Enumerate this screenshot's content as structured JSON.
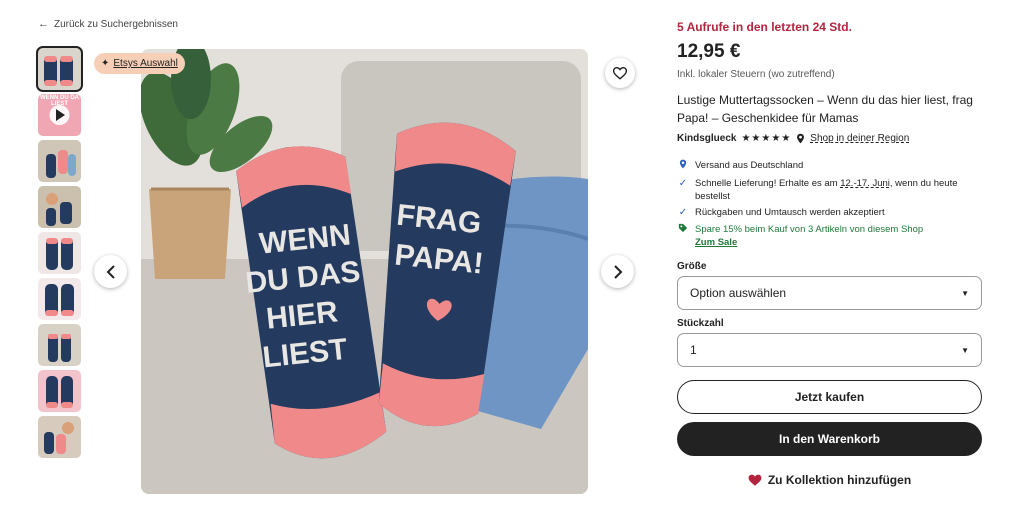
{
  "nav": {
    "back_label": "Zurück zu Suchergebnissen"
  },
  "gallery": {
    "badge_label": "Etsys Auswahl",
    "thumbnail_count": 9,
    "video_thumb_text": "WENN DU DA LIEST"
  },
  "product_image": {
    "left_sock_text": [
      "WENN",
      "DU DAS",
      "HIER",
      "LIEST"
    ],
    "right_sock_text": [
      "FRAG",
      "PAPA!"
    ]
  },
  "listing": {
    "views_text": "5 Aufrufe in den letzten 24 Std.",
    "price": "12,95 €",
    "tax_note": "Inkl. lokaler Steuern (wo zutreffend)",
    "title": "Lustige Muttertagssocken – Wenn du das hier liest, frag Papa! – Geschenkidee für Mamas",
    "shop_name": "Kindsglueck",
    "rating_stars": "★★★★★",
    "rating": 5,
    "shop_region_link": "Shop in deiner Region"
  },
  "features": {
    "shipping_from": "Versand aus Deutschland",
    "fast_delivery_prefix": "Schnelle Lieferung! Erhalte es am ",
    "fast_delivery_dates": "12.-17. Juni",
    "fast_delivery_suffix": ", wenn du heute bestellst",
    "returns": "Rückgaben und Umtausch werden akzeptiert",
    "discount": "Spare 15% beim Kauf von 3 Artikeln von diesem Shop",
    "sale_link": "Zum Sale"
  },
  "options": {
    "size_label": "Größe",
    "size_value": "Option auswählen",
    "qty_label": "Stückzahl",
    "qty_value": "1"
  },
  "actions": {
    "buy_now": "Jetzt kaufen",
    "add_to_cart": "In den Warenkorb",
    "add_to_collection": "Zu Kollektion hinzufügen"
  },
  "colors": {
    "accent_red": "#b3253f",
    "button_dark": "#222222",
    "sock_navy": "#243a5e",
    "sock_pink": "#f08a8a",
    "discount_green": "#1f7a3a"
  }
}
